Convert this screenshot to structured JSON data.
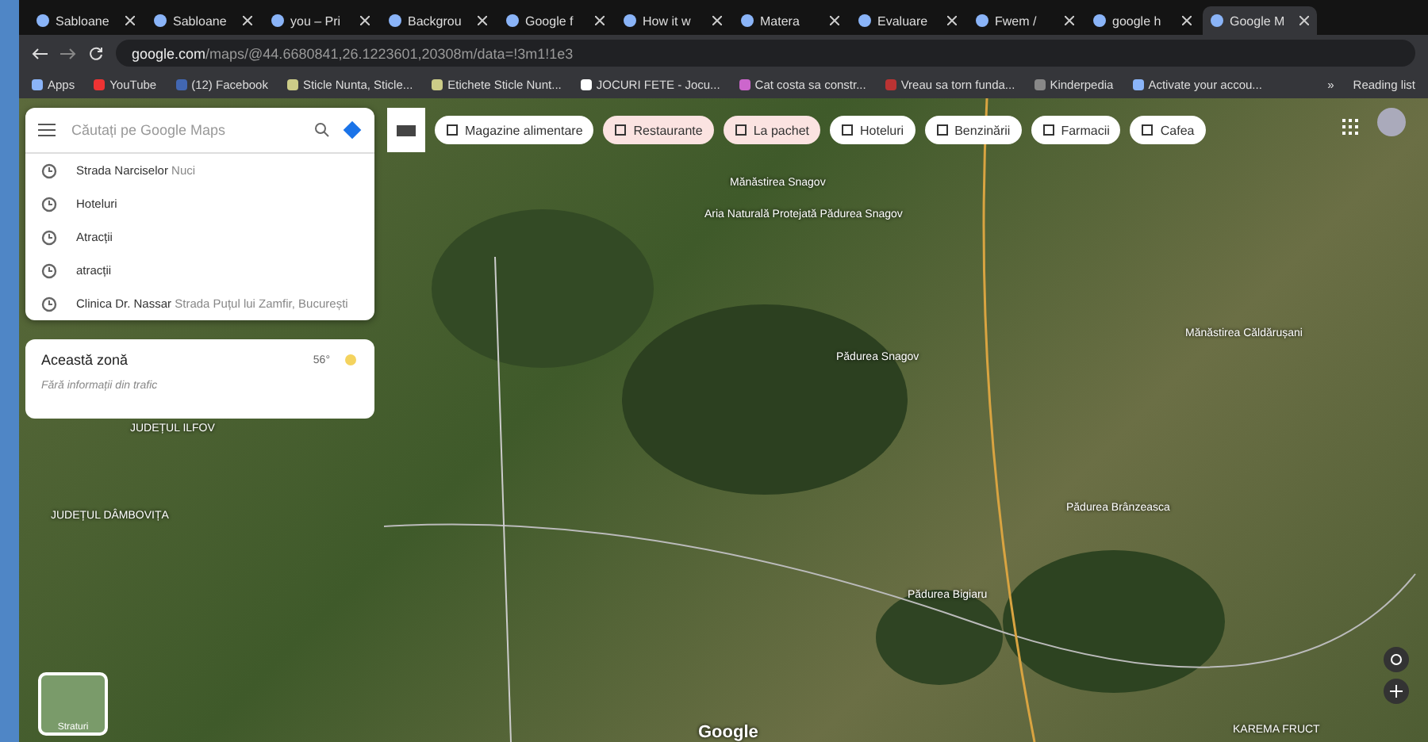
{
  "tabs": [
    {
      "title": "Sabloane",
      "selected": false
    },
    {
      "title": "Sabloane",
      "selected": false
    },
    {
      "title": "you – Pri",
      "selected": false
    },
    {
      "title": "Backgrou",
      "selected": false
    },
    {
      "title": "Google f",
      "selected": false
    },
    {
      "title": "How it w",
      "selected": false
    },
    {
      "title": "Matera",
      "selected": false
    },
    {
      "title": "Evaluare",
      "selected": false
    },
    {
      "title": "Fwem /",
      "selected": false
    },
    {
      "title": "google h",
      "selected": false
    },
    {
      "title": "Google M",
      "selected": true
    }
  ],
  "address_bar": {
    "url_host": "google.com",
    "url_path": "/maps/@44.6680841,26.1223601,20308m/data=!3m1!1e3"
  },
  "bookmarks": [
    {
      "label": "Apps"
    },
    {
      "label": "YouTube"
    },
    {
      "label": "(12) Facebook"
    },
    {
      "label": "Sticle Nunta, Sticle..."
    },
    {
      "label": "Etichete Sticle Nunt..."
    },
    {
      "label": "JOCURI FETE - Jocu..."
    },
    {
      "label": "Cat costa sa constr..."
    },
    {
      "label": "Vreau sa torn funda..."
    },
    {
      "label": "Kinderpedia"
    },
    {
      "label": "Activate your accou..."
    }
  ],
  "bookmarks_more": "»",
  "reading_list": "Reading list",
  "search": {
    "placeholder": "Căutați pe Google Maps"
  },
  "recent": [
    {
      "title": "Strada Narciselor",
      "detail": "Nuci"
    },
    {
      "title": "Hoteluri"
    },
    {
      "title": "Atracții"
    },
    {
      "title": "atracții"
    },
    {
      "title": "Clinica Dr. Nassar",
      "detail": "Strada Puțul lui Zamfir, București"
    }
  ],
  "area": {
    "title": "Această zonă",
    "temperature": "56°",
    "traffic": "Fără informații din trafic"
  },
  "chips": [
    {
      "label": "Magazine alimentare",
      "highlighted": false
    },
    {
      "label": "Restaurante",
      "highlighted": true
    },
    {
      "label": "La pachet",
      "highlighted": true
    },
    {
      "label": "Hoteluri",
      "highlighted": false
    },
    {
      "label": "Benzinării",
      "highlighted": false
    },
    {
      "label": "Farmacii",
      "highlighted": false
    },
    {
      "label": "Cafea",
      "highlighted": false
    }
  ],
  "map_labels": [
    "Mănăstirea Snagov",
    "Aria Naturală Protejată Pădurea Snagov",
    "Pădurea Snagov",
    "Mănăstirea Căldărușani",
    "Pădurea Brânzeasca",
    "Pădurea Bigiaru",
    "JUDEȚUL ILFOV",
    "JUDEȚUL DÂMBOVIȚA",
    "KAREMA FRUCT"
  ],
  "layers_label": "Straturi",
  "map_logo": "Google"
}
